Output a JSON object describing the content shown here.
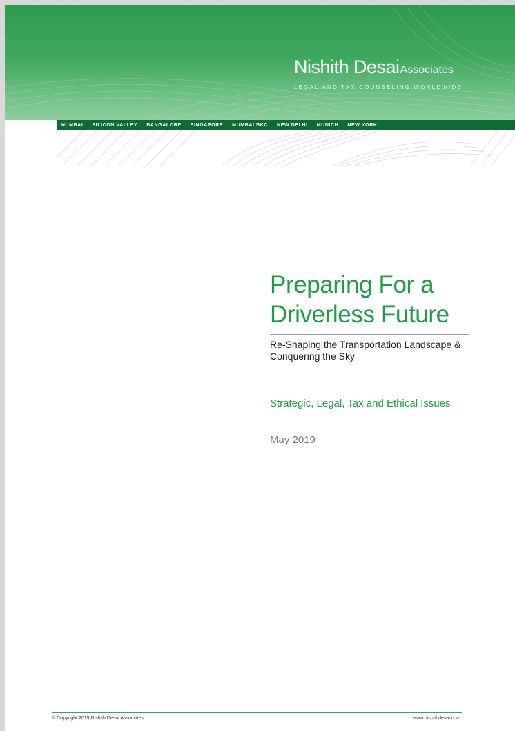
{
  "brand": {
    "name": "Nishith Desai",
    "suffix": "Associates",
    "tagline": "LEGAL AND TAX COUNSELING WORLDWIDE"
  },
  "cities": [
    "MUMBAI",
    "SILICON VALLEY",
    "BANGALORE",
    "SINGAPORE",
    "MUMBAI BKC",
    "NEW DELHI",
    "MUNICH",
    "NEW YORK"
  ],
  "document": {
    "title_line1": "Preparing For a",
    "title_line2": "Driverless Future",
    "subtitle": "Re-Shaping the Transportation Landscape & Conquering the Sky",
    "topics": "Strategic, Legal, Tax and Ethical Issues",
    "date": "May 2019"
  },
  "footer": {
    "copyright": "© Copyright 2019 Nishith Desai Associates",
    "website": "www.nishithdesai.com"
  },
  "colors": {
    "brand_green": "#1f9a48",
    "bar_green": "#116a35"
  }
}
